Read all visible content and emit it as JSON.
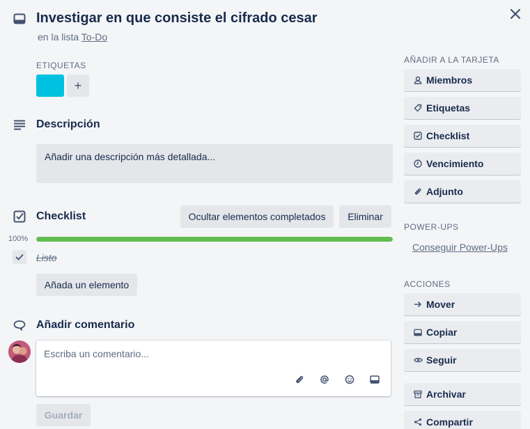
{
  "card": {
    "title": "Investigar en que consiste el cifrado cesar",
    "in_list_prefix": "en la lista",
    "list_name": "To-Do"
  },
  "labels": {
    "heading": "Etiquetas",
    "chip_color": "#00c2e0",
    "add_symbol": "+"
  },
  "description": {
    "heading": "Descripción",
    "placeholder": "Añadir una descripción más detallada..."
  },
  "checklist": {
    "heading": "Checklist",
    "hide_completed": "Ocultar elementos completados",
    "delete": "Eliminar",
    "progress_label": "100%",
    "progress": 1.0,
    "items": [
      {
        "text": "Listo",
        "checked": true
      }
    ],
    "add_item": "Añada un elemento"
  },
  "comment": {
    "heading": "Añadir comentario",
    "placeholder": "Escriba un comentario...",
    "save": "Guardar"
  },
  "sidebar": {
    "add_to_card": {
      "heading": "Añadir a la tarjeta",
      "buttons": [
        {
          "label": "Miembros",
          "icon": "person-icon"
        },
        {
          "label": "Etiquetas",
          "icon": "tag-icon"
        },
        {
          "label": "Checklist",
          "icon": "checkbox-icon"
        },
        {
          "label": "Vencimiento",
          "icon": "clock-icon"
        },
        {
          "label": "Adjunto",
          "icon": "paperclip-icon"
        }
      ]
    },
    "power_ups": {
      "heading": "Power-Ups",
      "link": "Conseguir Power-Ups"
    },
    "actions": {
      "heading": "Acciones",
      "buttons": [
        {
          "label": "Mover",
          "icon": "arrow-right-icon"
        },
        {
          "label": "Copiar",
          "icon": "card-icon"
        },
        {
          "label": "Seguir",
          "icon": "eye-icon"
        },
        {
          "label": "Archivar",
          "icon": "archive-icon"
        },
        {
          "label": "Compartir",
          "icon": "share-icon"
        }
      ]
    }
  },
  "colors": {
    "background": "#f4f5f7",
    "progress_complete": "#61bd4f",
    "text_primary": "#172b4d",
    "text_subtle": "#5e6c84"
  }
}
